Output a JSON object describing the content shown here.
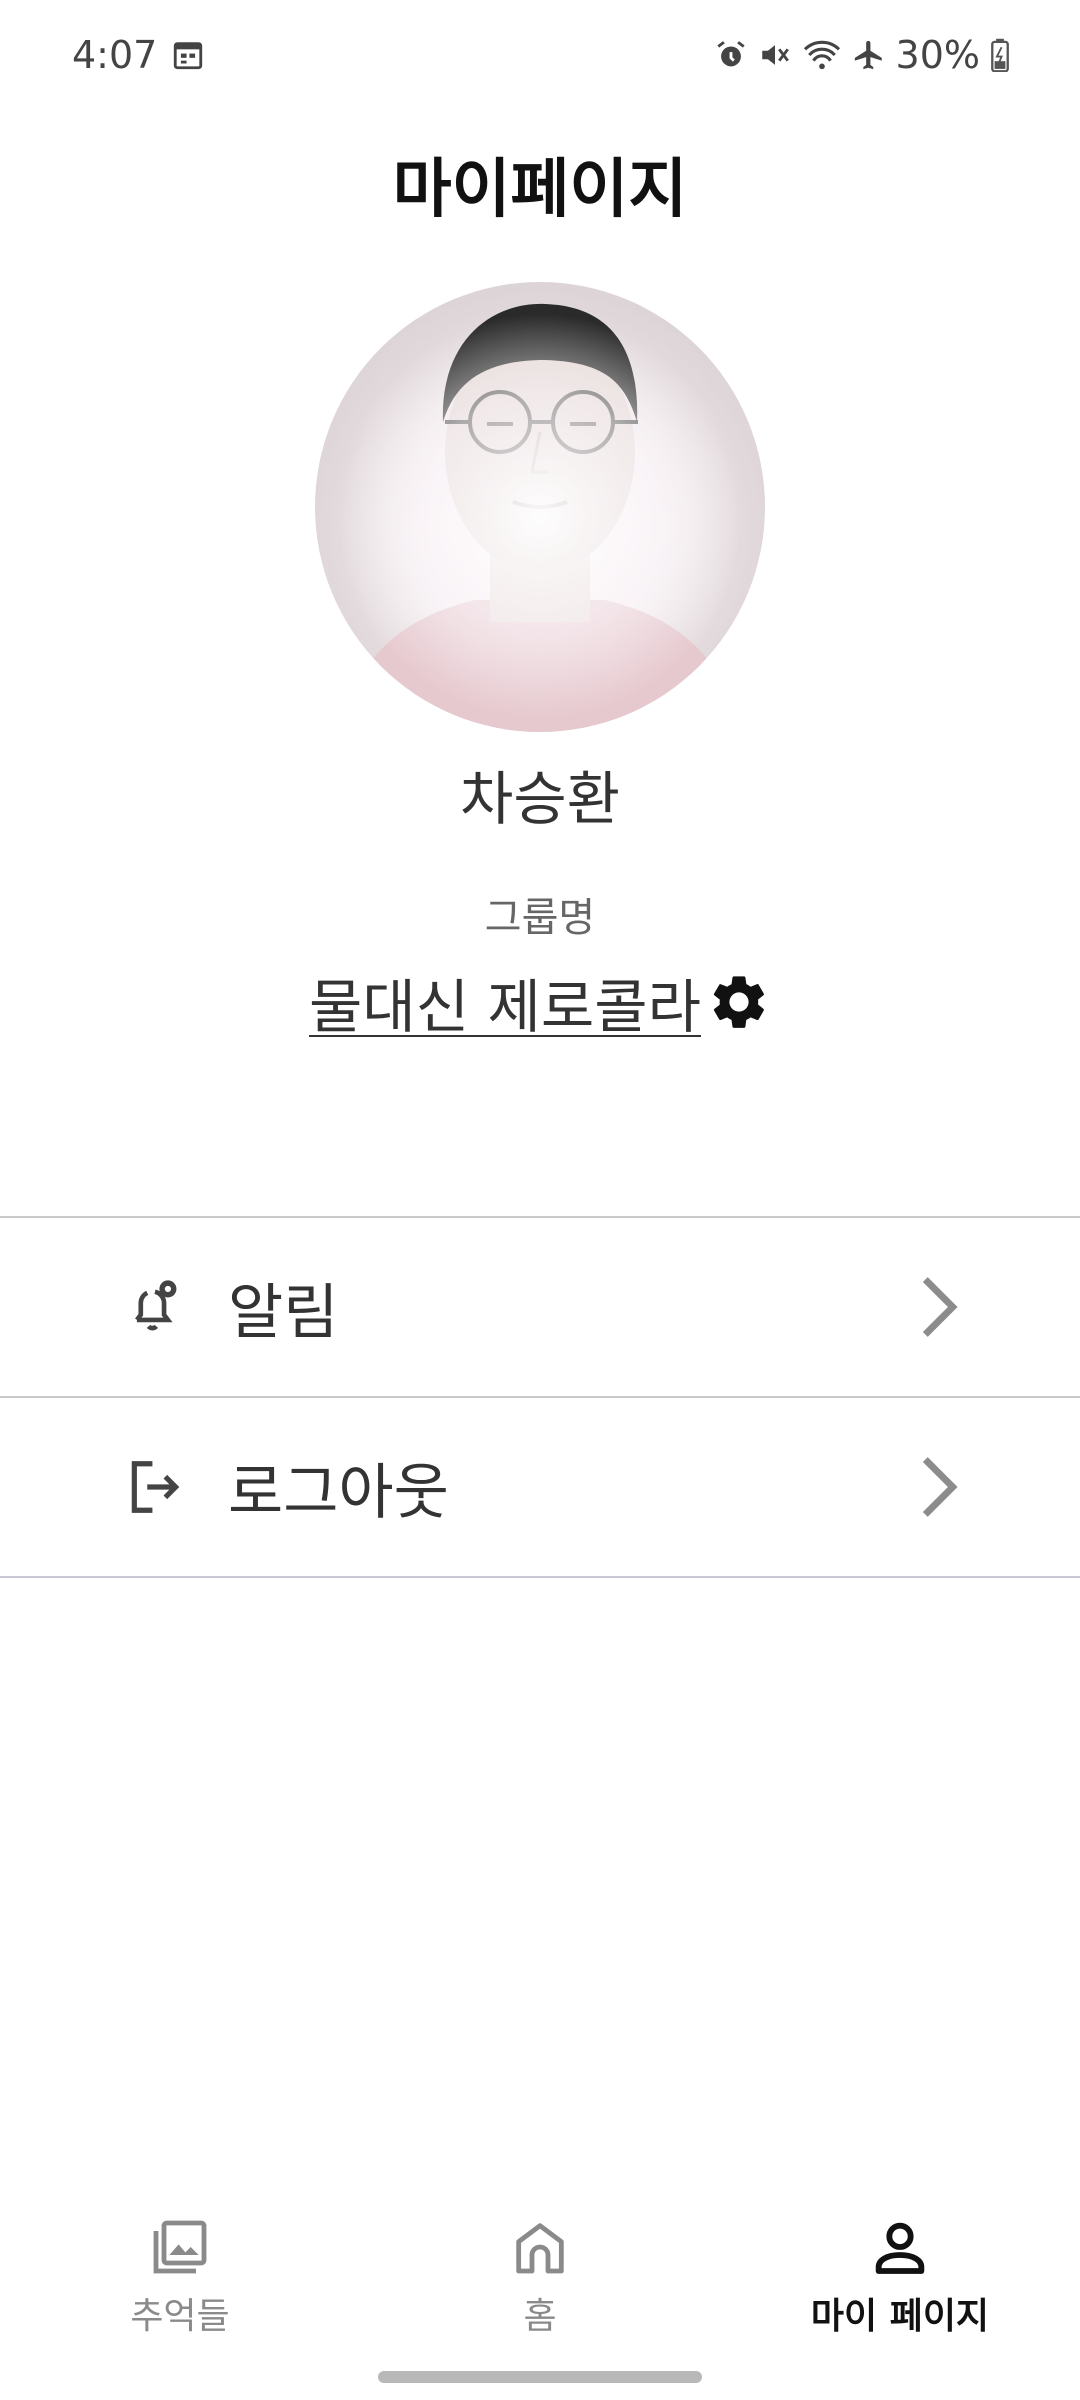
{
  "status_bar": {
    "time": "4:07",
    "battery": "30%",
    "icons": [
      "calendar-icon",
      "alarm-icon",
      "mute-icon",
      "wifi-icon",
      "airplane-icon",
      "battery-icon"
    ]
  },
  "header": {
    "title": "마이페이지"
  },
  "profile": {
    "avatar": "profile-photo",
    "name": "차승환",
    "group_label": "그룹명",
    "group_name": "물대신 제로콜라"
  },
  "menu": {
    "items": [
      {
        "label": "알림",
        "icon": "bell-settings-icon"
      },
      {
        "label": "로그아웃",
        "icon": "logout-icon"
      }
    ]
  },
  "bottom_nav": {
    "items": [
      {
        "label": "추억들",
        "icon": "gallery-icon",
        "active": false
      },
      {
        "label": "홈",
        "icon": "home-icon",
        "active": false
      },
      {
        "label": "마이 페이지",
        "icon": "person-icon",
        "active": true
      }
    ]
  },
  "colors": {
    "text_primary": "#111111",
    "text_secondary": "#666666",
    "divider": "#c9c9cc",
    "nav_inactive": "#8a8a8a"
  }
}
